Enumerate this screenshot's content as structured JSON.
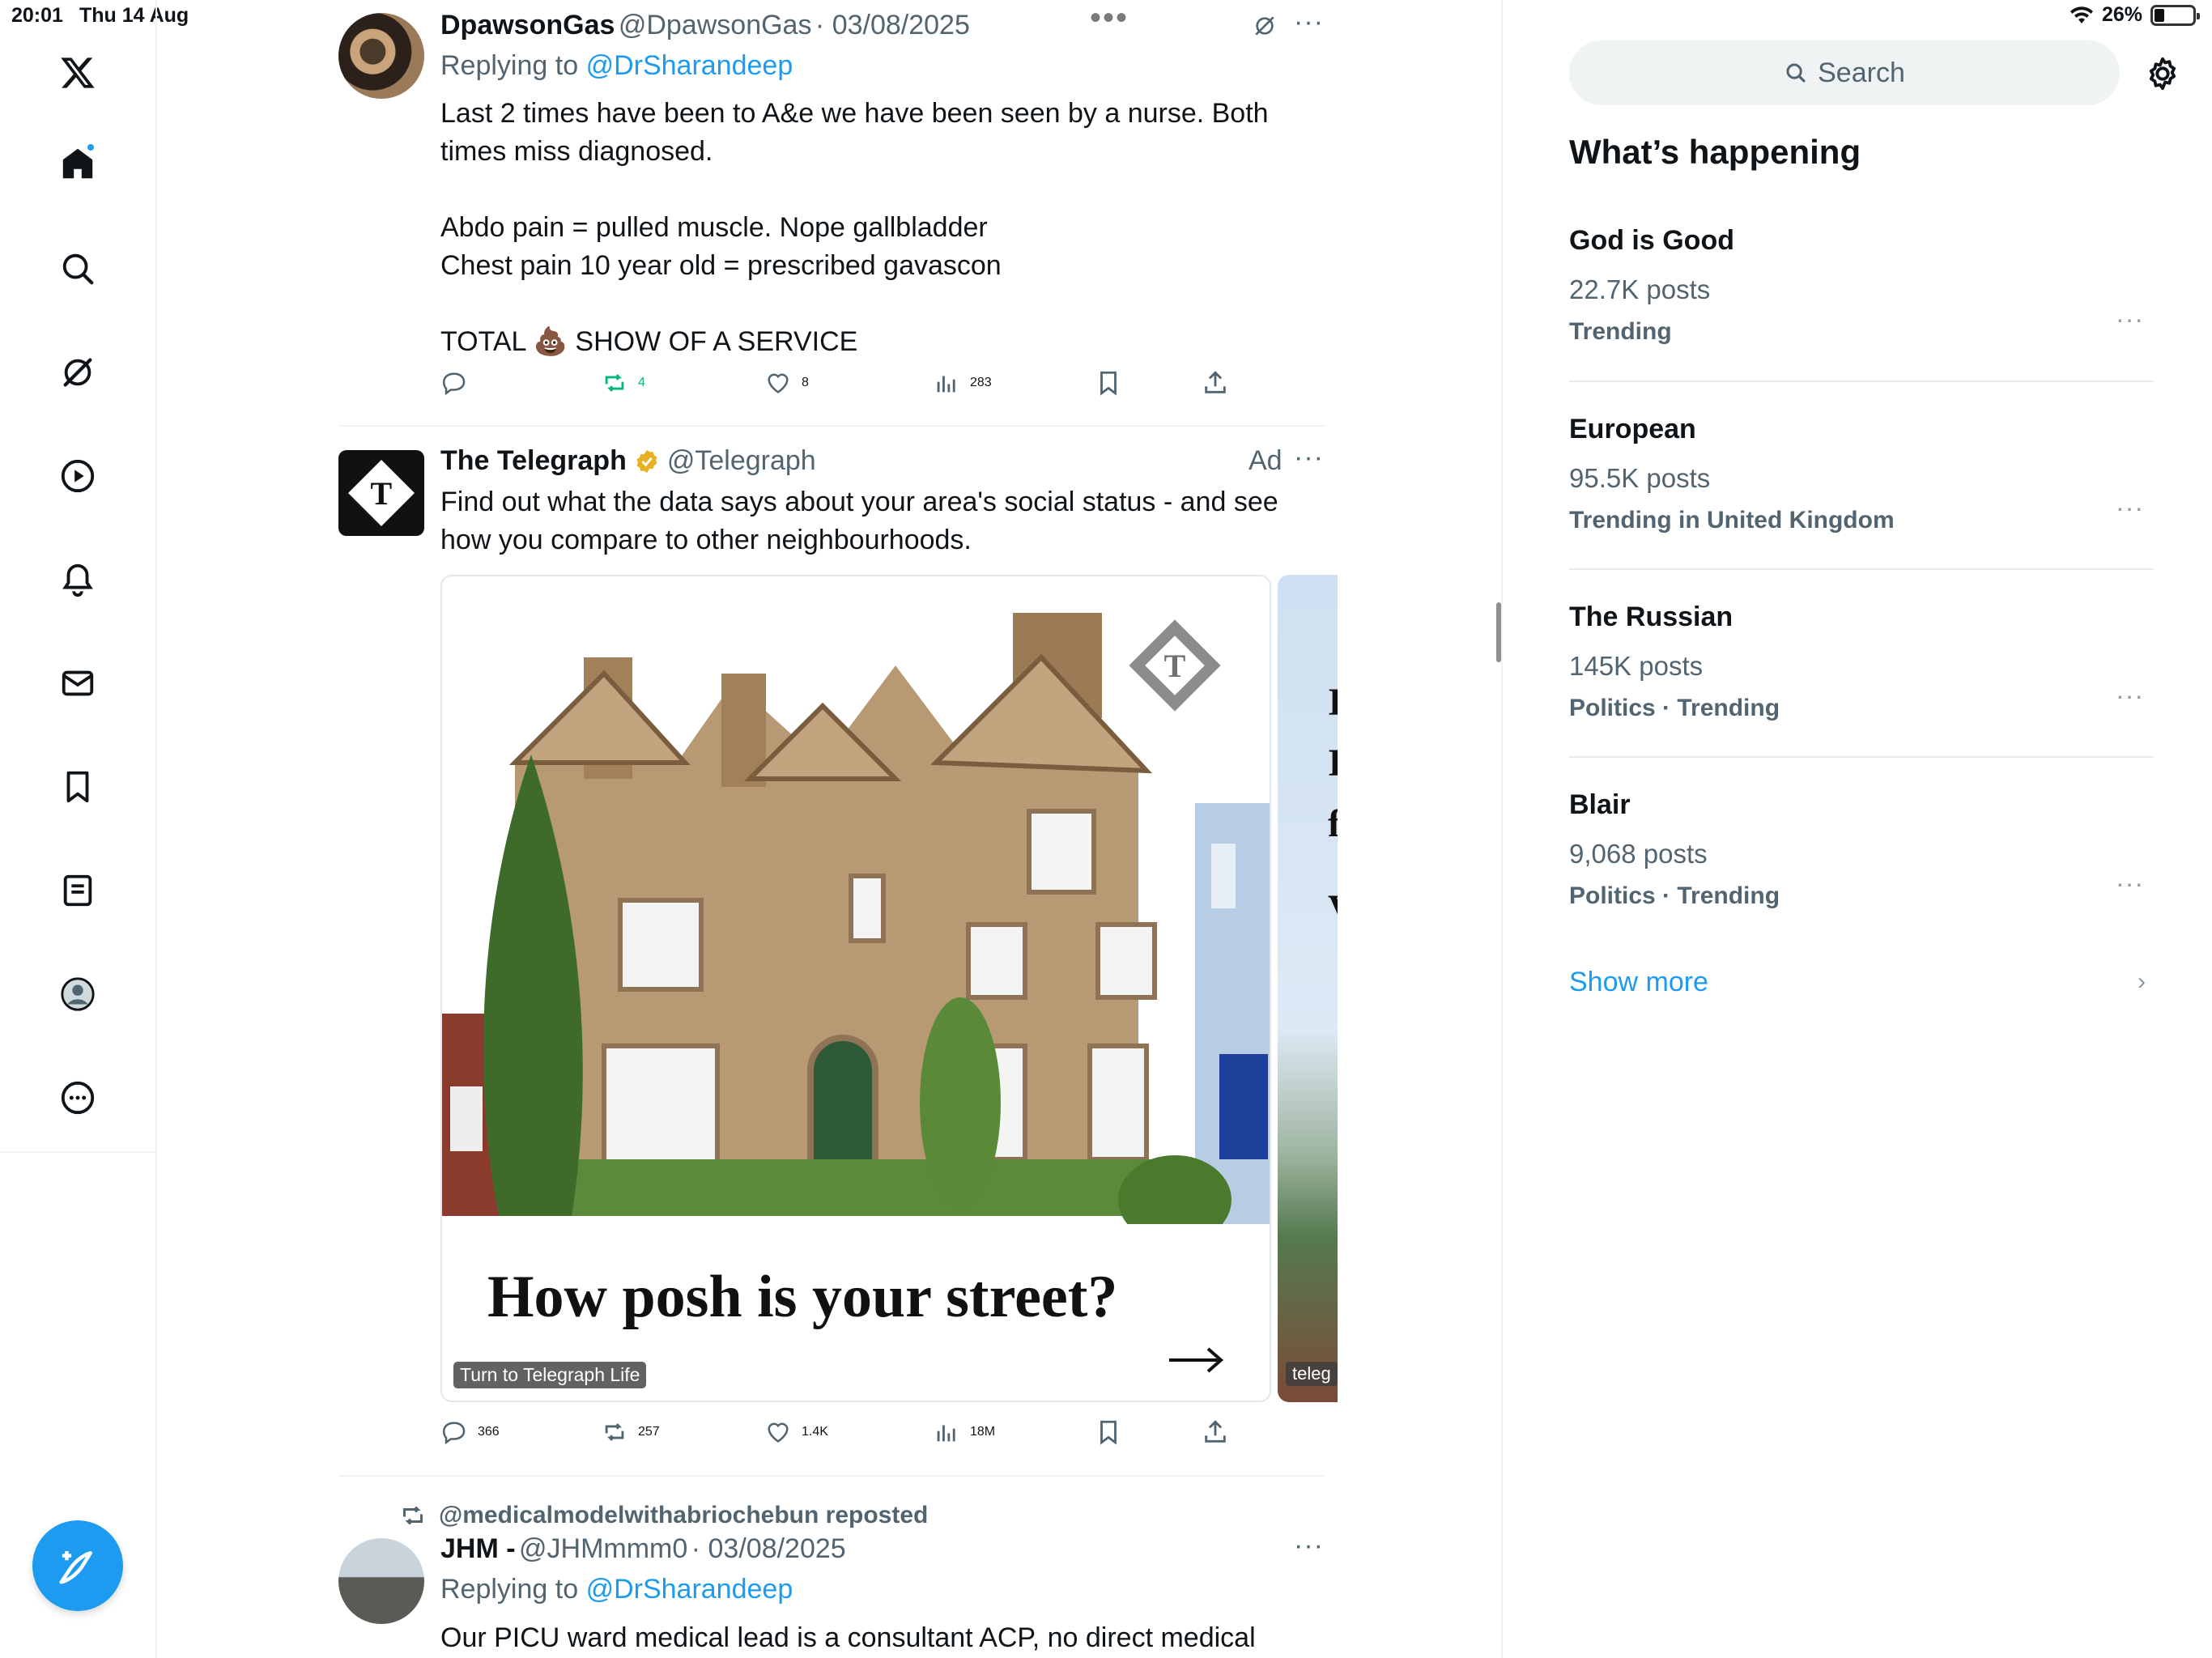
{
  "status_bar": {
    "time": "20:01",
    "date": "Thu 14 Aug",
    "battery": "26%",
    "battery_level": 0.26
  },
  "sidebar": {
    "items": [
      {
        "name": "x-logo-icon"
      },
      {
        "name": "home-icon"
      },
      {
        "name": "search-icon"
      },
      {
        "name": "grok-icon"
      },
      {
        "name": "video-icon"
      },
      {
        "name": "notifications-icon"
      },
      {
        "name": "messages-icon"
      },
      {
        "name": "bookmarks-icon"
      },
      {
        "name": "lists-icon"
      },
      {
        "name": "profile-icon"
      },
      {
        "name": "more-icon"
      }
    ],
    "compose_icon": "compose-icon"
  },
  "tweets": [
    {
      "name": "DpawsonGas",
      "handle": "@DpawsonGas",
      "date": "· 03/08/2025",
      "replying_label": "Replying to",
      "replying_to": "@DrSharandeep",
      "text": "Last 2 times have been to A&e we have been seen by a nurse. Both times miss diagnosed.\n\nAbdo pain = pulled muscle. Nope gallbladder\nChest pain 10 year old = prescribed gavascon\n\nTOTAL 💩 SHOW OF A SERVICE",
      "retweets": "4",
      "likes": "8",
      "views": "283"
    },
    {
      "name": "The Telegraph",
      "handle": "@Telegraph",
      "ad_label": "Ad",
      "text": "Find out what the data says about your area's social status - and see how you compare to other neighbourhoods.",
      "card_title": "How posh is your street?",
      "card_tag": "Turn to Telegraph Life",
      "card2_tag": "teleg",
      "card2_letters": [
        "I",
        "I",
        "f",
        "V"
      ],
      "replies": "366",
      "retweets": "257",
      "likes": "1.4K",
      "views": "18M"
    },
    {
      "reposted_by": "@medicalmodelwithabriochebun reposted",
      "name": "JHM -",
      "handle": "@JHMmmm0",
      "date": "· 03/08/2025",
      "replying_label": "Replying to",
      "replying_to": "@DrSharandeep",
      "text": "Our PICU ward medical lead is a consultant ACP, no direct medical"
    }
  ],
  "right": {
    "search_placeholder": "Search",
    "whats_happening": "What’s happening",
    "trends": [
      {
        "name": "God is Good",
        "count": "22.7K posts",
        "context": "Trending"
      },
      {
        "name": "European",
        "count": "95.5K posts",
        "context": "Trending in United Kingdom"
      },
      {
        "name": "The Russian",
        "count": "145K posts",
        "context": "Politics · Trending"
      },
      {
        "name": "Blair",
        "count": "9,068 posts",
        "context": "Politics · Trending"
      }
    ],
    "show_more": "Show more"
  },
  "colors": {
    "accent": "#1d9bf0",
    "text": "#0f1419",
    "muted": "#536471",
    "retweet_green": "#00ba7c"
  }
}
